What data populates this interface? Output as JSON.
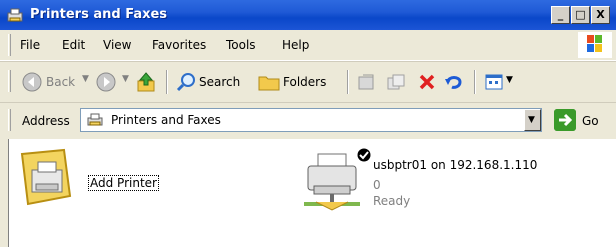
{
  "window": {
    "title": "Printers and Faxes",
    "controls": {
      "minimize": "_",
      "maximize": "□",
      "close": "X"
    }
  },
  "menu": {
    "items": [
      {
        "label": "File",
        "icon": null
      },
      {
        "label": "Edit",
        "icon": null
      },
      {
        "label": "View",
        "icon": null
      },
      {
        "label": "Favorites",
        "icon": null
      },
      {
        "label": "Tools",
        "icon": null
      },
      {
        "label": "Help",
        "icon": null
      }
    ]
  },
  "toolbar": {
    "back_label": "Back",
    "search_label": "Search",
    "folders_label": "Folders"
  },
  "address": {
    "label": "Address",
    "value": "Printers and Faxes",
    "go_label": "Go"
  },
  "items": {
    "add_printer": {
      "label": "Add Printer"
    },
    "printer": {
      "name": "usbptr01 on 192.168.1.110",
      "documents": "0",
      "status": "Ready"
    }
  },
  "colors": {
    "titlebar": "#0a47c9",
    "chrome": "#ece9d8"
  }
}
